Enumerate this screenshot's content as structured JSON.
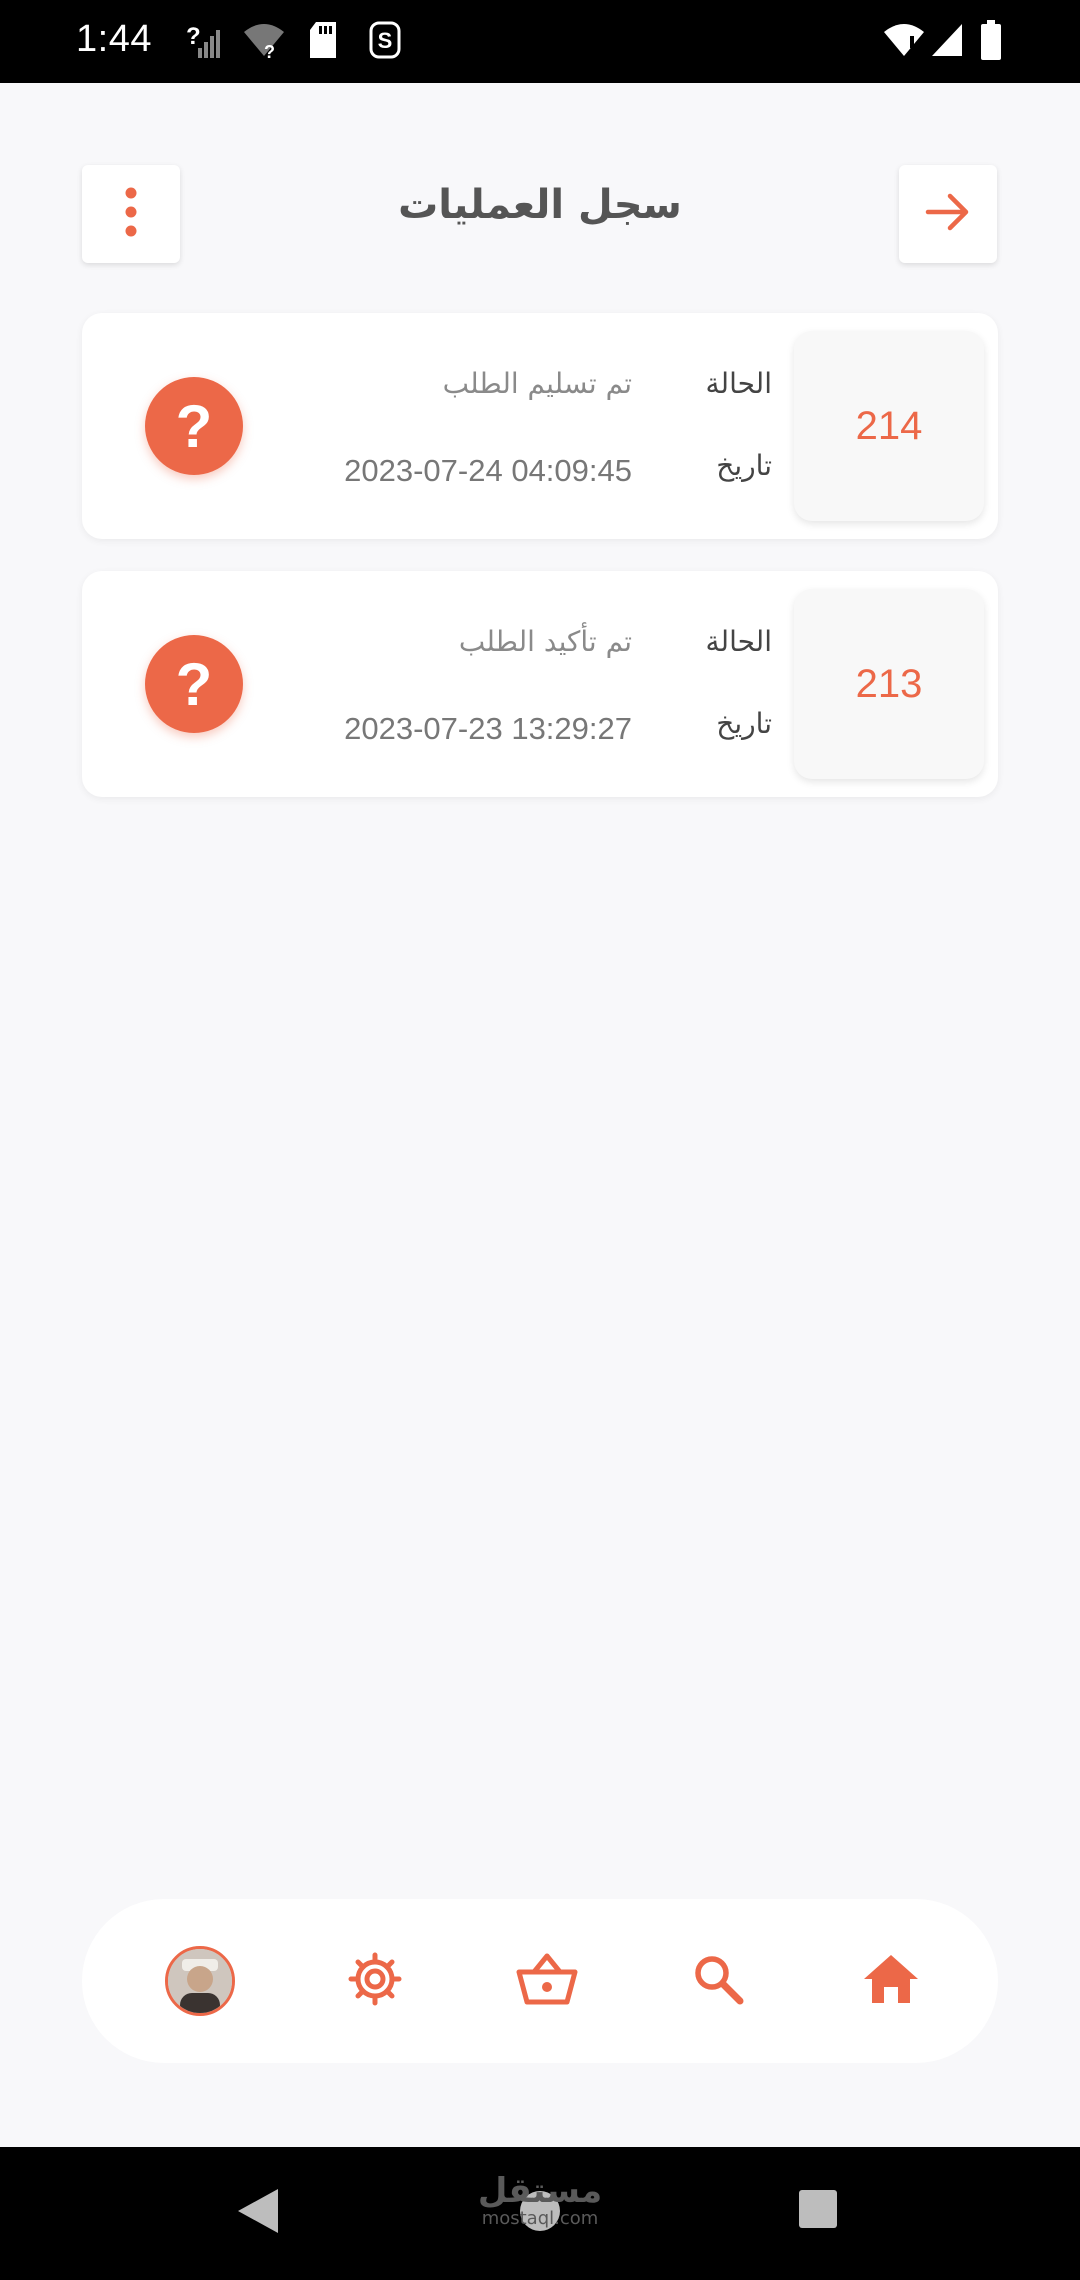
{
  "status_bar": {
    "time": "1:44",
    "icons": [
      "signal-unknown-icon",
      "wifi-unknown-icon",
      "sd-card-icon",
      "app-s-icon",
      "wifi-alert-icon",
      "cell-signal-icon",
      "battery-icon"
    ]
  },
  "header": {
    "title": "سجل العمليات",
    "menu_icon": "more-vertical-icon",
    "back_icon": "arrow-right-icon"
  },
  "cards": [
    {
      "order_id": "214",
      "status_label": "الحالة",
      "status_value": "تم تسليم الطلب",
      "date_label": "تاريخ",
      "date_value": "2023-07-24 04:09:45",
      "status_icon": "question-icon",
      "status_symbol": "?"
    },
    {
      "order_id": "213",
      "status_label": "الحالة",
      "status_value": "تم تأكيد الطلب",
      "date_label": "تاريخ",
      "date_value": "2023-07-23 13:29:27",
      "status_icon": "question-icon",
      "status_symbol": "?"
    }
  ],
  "bottom_nav": {
    "items": [
      "profile-avatar",
      "settings-icon",
      "basket-icon",
      "search-icon",
      "home-icon"
    ]
  },
  "watermark": {
    "arabic": "مستقل",
    "latin": "mostaql.com"
  },
  "colors": {
    "accent": "#ec6848",
    "background": "#f8f8fa",
    "card": "#ffffff"
  }
}
